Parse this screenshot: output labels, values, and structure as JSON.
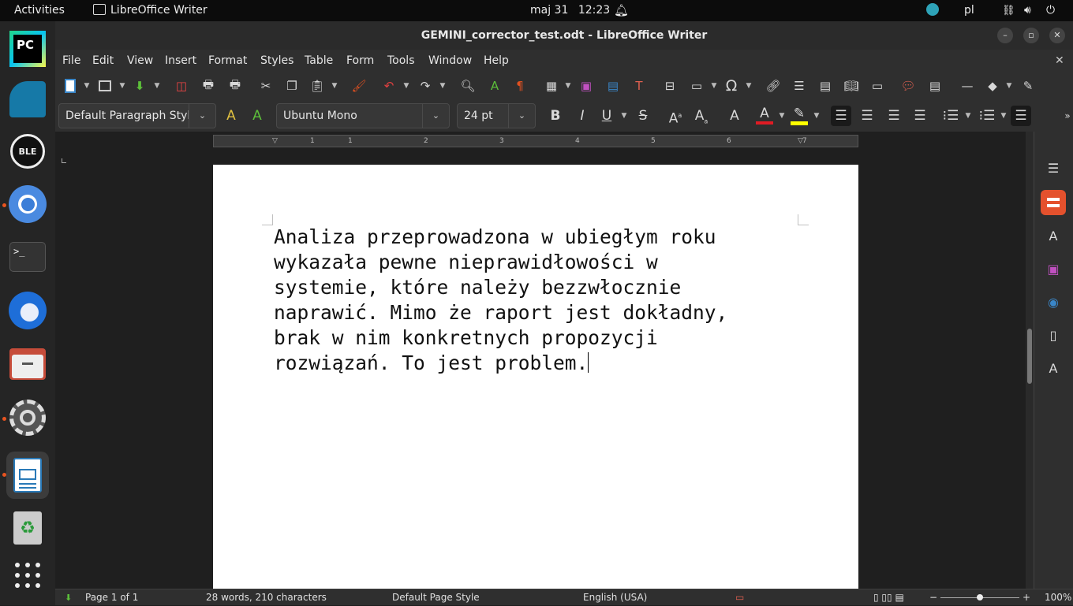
{
  "topbar": {
    "activities": "Activities",
    "app_name": "LibreOffice Writer",
    "date": "maj 31",
    "time": "12:23",
    "keyboard_layout": "pl"
  },
  "dock": {
    "items": [
      {
        "name": "PyCharm",
        "label": "PC"
      },
      {
        "name": "Wireshark",
        "label": ""
      },
      {
        "name": "BLE Scanner",
        "label": "BLE"
      },
      {
        "name": "Chromium",
        "label": ""
      },
      {
        "name": "Terminal",
        "label": ">_"
      },
      {
        "name": "Thunderbird",
        "label": ""
      },
      {
        "name": "Files",
        "label": ""
      },
      {
        "name": "Settings",
        "label": ""
      },
      {
        "name": "LibreOffice Writer",
        "label": ""
      },
      {
        "name": "Trash",
        "label": "♻"
      },
      {
        "name": "Show Applications",
        "label": ""
      }
    ]
  },
  "window": {
    "title": "GEMINI_corrector_test.odt - LibreOffice Writer"
  },
  "menubar": [
    "File",
    "Edit",
    "View",
    "Insert",
    "Format",
    "Styles",
    "Table",
    "Form",
    "Tools",
    "Window",
    "Help"
  ],
  "formatting": {
    "paragraph_style": "Default Paragraph Styl",
    "font_name": "Ubuntu Mono",
    "font_size": "24 pt"
  },
  "ruler": {
    "numbers": [
      "1",
      "1",
      "2",
      "3",
      "4",
      "5",
      "6",
      "7"
    ]
  },
  "document": {
    "lines": [
      "Analiza przeprowadzona w ubiegłym roku",
      "wykazała pewne nieprawidłowości w",
      "systemie, które należy bezzwłocznie",
      "naprawić. Mimo że raport jest dokładny,",
      "brak w nim konkretnych propozycji",
      "rozwiązań. To jest problem."
    ]
  },
  "statusbar": {
    "page": "Page 1 of 1",
    "word_count": "28 words, 210 characters",
    "page_style": "Default Page Style",
    "language": "English (USA)",
    "zoom": "100%"
  },
  "colors": {
    "accent": "#e95420",
    "sidebar_red": "#e4512d",
    "font_color": "#e01b24",
    "highlight": "#ffff00"
  }
}
